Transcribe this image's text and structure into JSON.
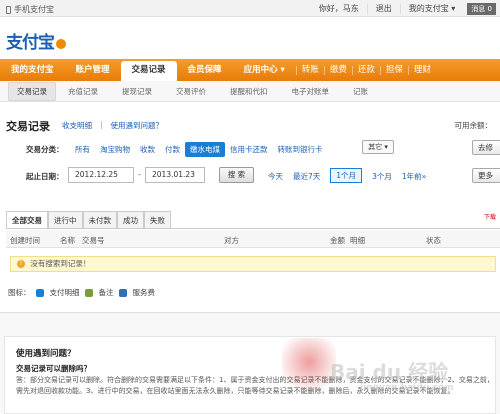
{
  "topbar": {
    "mobile_label": "手机支付宝",
    "greeting": "你好，马东",
    "logout": "退出",
    "my_alipay": "我的支付宝 ▾",
    "messages": "消息 0"
  },
  "logo": {
    "text": "支付宝"
  },
  "mainnav": {
    "items": [
      "我的支付宝",
      "账户管理",
      "交易记录",
      "会员保障",
      "应用中心 ▾"
    ],
    "sub_items": [
      "转账",
      "缴费",
      "还款",
      "担保",
      "理财"
    ]
  },
  "subnav": {
    "items": [
      "交易记录",
      "充值记录",
      "提现记录",
      "交易评价",
      "提醒和代扣",
      "电子对账单",
      "记账"
    ]
  },
  "page": {
    "title": "交易记录",
    "link1": "收支明细",
    "link2": "使用遇到问题？",
    "balance_label": "可用余额："
  },
  "filters": {
    "category_label": "交易分类：",
    "categories": [
      "所有",
      "淘宝购物",
      "收款",
      "付款",
      "缴水电煤",
      "信用卡还款",
      "转账到银行卡"
    ],
    "other": "其它 ▾",
    "right_btn1": "去修",
    "date_label": "起止日期：",
    "start_date": "2012.12.25",
    "end_date": "2013.01.23",
    "dash": "-",
    "search": "搜 索",
    "quick": [
      "今天",
      "最近7天",
      "1个月",
      "3个月",
      "1年前»"
    ],
    "right_btn2": "更多"
  },
  "tabs": [
    "全部交易",
    "进行中",
    "未付款",
    "成功",
    "失败"
  ],
  "export_hint": "下载",
  "table": {
    "headers": [
      "创建时间",
      "名称",
      "交易号",
      "对方",
      "金额",
      "明细",
      "状态"
    ]
  },
  "notice": {
    "text": "没有搜索到记录！"
  },
  "legend": {
    "label": "图标：",
    "items": [
      "支付明细",
      "备注",
      "服务费"
    ]
  },
  "help": {
    "title": "使用遇到问题？",
    "question": "交易记录可以删除吗？",
    "answer": "答：部分交易记录可以删除。符合删除的交易需要满足以下条件：1、属于资金支付出的交易记录不能删除，资金支付的交易记录不能删除；2、交易之前，需先对退回收款功能。3、进行中的交易，在回收站里面无法永久删除，只能等待交易记录不能删除，删除后，永久删除的交易记录不能恢复。"
  },
  "watermark": {
    "main": "Bai du 经验",
    "sub": "jingyan.baidu.com"
  }
}
